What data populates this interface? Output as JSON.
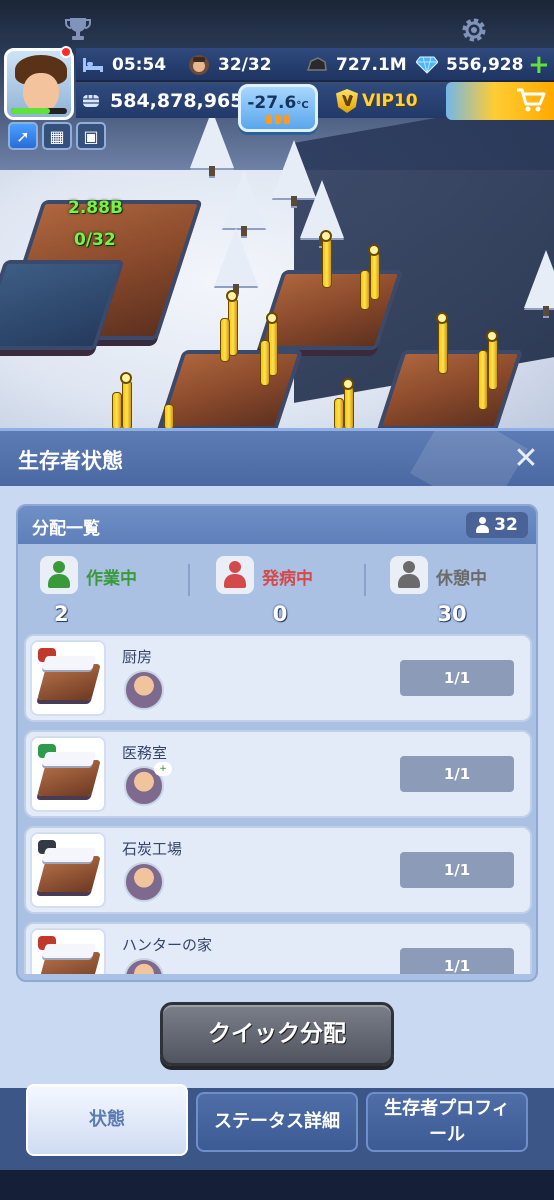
{
  "hud": {
    "time": "05:54",
    "survivors": "32/32",
    "coal": "727.1M",
    "gems": "556,928",
    "power": "584,878,965",
    "temperature_value": "-27.6",
    "temperature_unit": "°C",
    "vip": "VIP10",
    "shield_letter": "V",
    "add_symbol": "+"
  },
  "scene": {
    "float_value": "2.88B",
    "float_workers": "0/32"
  },
  "panel": {
    "title": "生存者状態",
    "close_symbol": "✕",
    "allocation": {
      "title": "分配一覧",
      "total": "32",
      "stats": [
        {
          "label": "作業中",
          "value": "2",
          "color": "#3a9a3a"
        },
        {
          "label": "発病中",
          "value": "0",
          "color": "#d44a4a"
        },
        {
          "label": "休憩中",
          "value": "30",
          "color": "#6b6b6b"
        }
      ],
      "jobs": [
        {
          "name": "厨房",
          "count": "1/1",
          "tag_color": "#c0392b",
          "bubble": ""
        },
        {
          "name": "医務室",
          "count": "1/1",
          "tag_color": "#2e9a4c",
          "bubble": "+"
        },
        {
          "name": "石炭工場",
          "count": "1/1",
          "tag_color": "#333a44",
          "bubble": ""
        },
        {
          "name": "ハンターの家",
          "count": "1/1",
          "tag_color": "#c0392b",
          "bubble": ""
        }
      ]
    },
    "quick_button": "クイック分配"
  },
  "tabs": [
    {
      "label": "状態",
      "active": true
    },
    {
      "label": "ステータス詳細",
      "active": false
    },
    {
      "label": "生存者プロフィール",
      "active": false
    }
  ],
  "colors": {
    "accent_green": "#5fe23a",
    "panel_bg": "#c9d9f1",
    "header_blue": "#4a68a2"
  },
  "icons": [
    "trophy-icon",
    "gear-icon",
    "bed-icon",
    "survivor-face-icon",
    "coal-icon",
    "diamond-icon",
    "plus-icon",
    "fist-icon",
    "shopping-cart-icon",
    "arrow-up-icon",
    "person-icon",
    "close-icon"
  ]
}
